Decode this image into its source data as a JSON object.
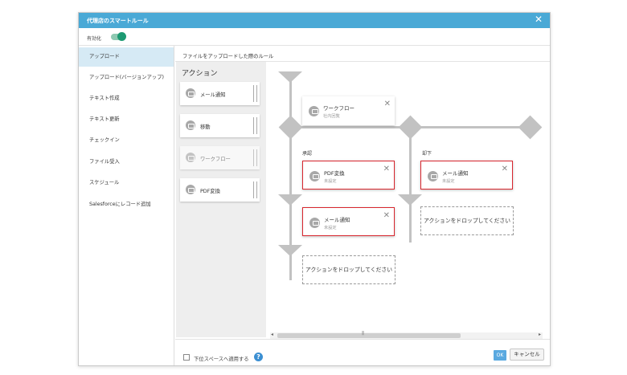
{
  "dialog": {
    "title": "代理店のスマートルール",
    "close_icon": "close-icon"
  },
  "toggle": {
    "label": "有効化",
    "state": "on",
    "color": "#1d9a72"
  },
  "sidebar": {
    "items": [
      {
        "label": "アップロード",
        "active": true
      },
      {
        "label": "アップロード(バージョンアップ)"
      },
      {
        "label": "テキスト作成"
      },
      {
        "label": "テキスト更新"
      },
      {
        "label": "チェックイン"
      },
      {
        "label": "ファイル受入"
      },
      {
        "label": "スケジュール"
      },
      {
        "label": "Salesforceにレコード追加"
      }
    ]
  },
  "content": {
    "header": "ファイルをアップロードした際のルール"
  },
  "palette": {
    "title": "アクション",
    "items": [
      {
        "label": "メール通知",
        "icon": "mail-icon"
      },
      {
        "label": "移動",
        "icon": "move-icon"
      },
      {
        "label": "ワークフロー",
        "icon": "workflow-icon",
        "disabled": true
      },
      {
        "label": "PDF変換",
        "icon": "pdf-icon"
      }
    ]
  },
  "flow": {
    "workflow_node": {
      "title": "ワークフロー",
      "sub": "社内回覧",
      "icon": "workflow-icon"
    },
    "branches": {
      "approve": "承認",
      "reject": "却下"
    },
    "pdf_node": {
      "title": "PDF変換",
      "sub": "未設定",
      "icon": "pdf-icon"
    },
    "mail_node_reject": {
      "title": "メール通知",
      "sub": "未設定",
      "icon": "mail-icon"
    },
    "mail_node_approve": {
      "title": "メール通知",
      "sub": "未設定",
      "icon": "mail-icon"
    },
    "drop_text": "アクションをドロップしてください",
    "error_color": "#d8262e"
  },
  "footer": {
    "checkbox_label": "下位スペースへ適用する",
    "help_label": "?",
    "ok_label": "OK",
    "cancel_label": "キャンセル"
  },
  "colors": {
    "titlebar": "#4aa9d6",
    "selected_item": "#d6eaf5",
    "ok_button": "#5aa9e0"
  }
}
